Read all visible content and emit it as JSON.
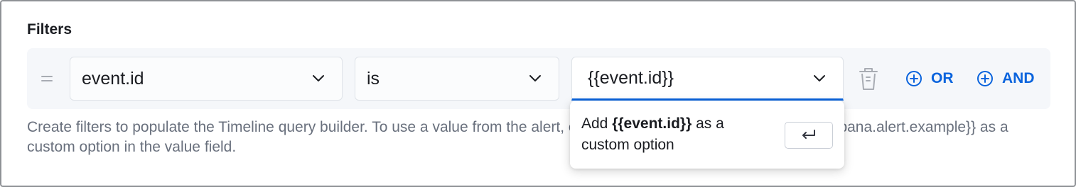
{
  "section": {
    "title": "Filters"
  },
  "filter": {
    "field": "event.id",
    "operator": "is",
    "value": "{{event.id}}"
  },
  "actions": {
    "or_label": "OR",
    "and_label": "AND"
  },
  "help": {
    "text": "Create filters to populate the Timeline query builder. To use a value from the alert, enter the field name in double braces {{kibana.alert.example}} as a custom option in the value field."
  },
  "popover": {
    "prefix": "Add ",
    "value": "{{event.id}}",
    "suffix": " as a custom option"
  },
  "colors": {
    "accent": "#0b64dd",
    "row_background": "#f5f7fa",
    "help_text": "#69707d"
  },
  "icons": {
    "drag": "drag-handle-icon",
    "chevron": "chevron-down-icon",
    "delete": "trash-icon",
    "add": "plus-circle-icon",
    "enter": "enter-key-icon"
  }
}
